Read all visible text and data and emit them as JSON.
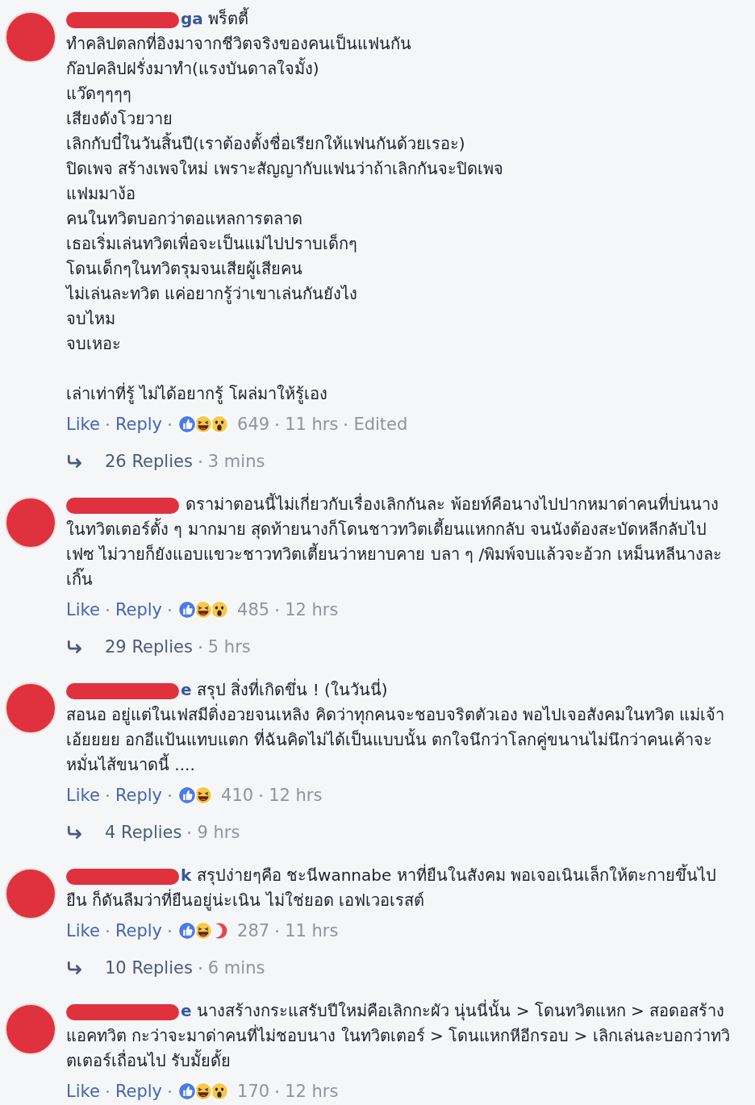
{
  "comments": [
    {
      "name": "ga",
      "text": "พร็ตตี้\nทำคลิปตลกที่อิงมาจากชีวิตจริงของคนเป็นแฟนกัน\nก๊อปคลิปฝรั่งมาทำ(แรงบันดาลใจมั้ง)\nแว๊ดๆๆๆๆ\nเสียงดังโวยวาย\nเลิกกับบี๋ในวันสิ้นปี(เราต้องตั้งชื่อเรียกให้แฟนกันด้วยเรอะ)\nปิดเพจ สร้างเพจใหม่ เพราะสัญญากับแฟนว่าถ้าเลิกกันจะปิดเพจ\nแฟมมาง้อ\nคนในทวิตบอกว่าตอแหลการตลาด\nเธอเริ่มเล่นทวิตเพื่อจะเป็นแม่ไปปราบเด็กๆ\nโดนเด็กๆในทวิตรุมจนเสียผู้เสียคน\nไม่เล่นละทวิต แค่อยากรู้ว่าเขาเล่นกันยังไง\nจบไหม\nจบเหอะ\n\nเล่าเท่าที่รู้ ไม่ได้อยากรู้ โผล่มาให้รู้เอง",
      "like": "Like",
      "reply": "Reply",
      "reactions": [
        {
          "kind": "like"
        },
        {
          "kind": "haha"
        },
        {
          "kind": "wow"
        }
      ],
      "count": "649",
      "time": "11 hrs",
      "edited": "Edited",
      "replies": "26 Replies",
      "replies_time": "3 mins"
    },
    {
      "text": "ดราม่าตอนนี้ไม่เกี่ยวกับเรื่องเลิกกันละ พ้อยท์คือนางไปปากหมาด่าคนที่บ่นนางในทวิตเตอร์ตั้ง ๆ มากมาย สุดท้ายนางก็โดนชาวทวิตเตี้ยนแหกกลับ จนนังต้องสะบัดหลีกลับไปเฟซ ไม่วายก็ยังแอบแขวะชาวทวิตเตี้ยนว่าหยาบคาย บลา ๆ /พิมพ์จบแล้วจะอ้วก เหม็นหลีนางละเกิ๊น",
      "like": "Like",
      "reply": "Reply",
      "reactions": [
        {
          "kind": "like"
        },
        {
          "kind": "haha"
        },
        {
          "kind": "wow"
        }
      ],
      "count": "485",
      "time": "12 hrs",
      "replies": "29 Replies",
      "replies_time": "5 hrs"
    },
    {
      "name": "e",
      "text": "สรุป สิ่งที่เกิดขึ่น ! (ในวันนี่)\nสอนอ อยู่แต่ในเฟสมีติ่งอวยจนเหลิง คิดว่าทุกคนจะชอบจริตตัวเอง พอไปเจอสังคมในทวิต แม่เจ้าเอ้ยยยย อกอีแป้นแทบแตก ที่ฉันคิดไม่ได้เป็นแบบนั้น ตกใจนึกว่าโลกคู่ขนานไม่นึกว่าคนเค้าจะหมั่นไส้ขนาดนี้ ....",
      "like": "Like",
      "reply": "Reply",
      "reactions": [
        {
          "kind": "like"
        },
        {
          "kind": "haha"
        }
      ],
      "count": "410",
      "time": "12 hrs",
      "replies": "4 Replies",
      "replies_time": "9 hrs"
    },
    {
      "name": "k",
      "text": "สรุปง่ายๆคือ ชะนีwannabe หาที่ยืนในสังคม พอเจอเนินเล็กให้ตะกายขึ้นไปยืน ก็ดันลืมว่าที่ยืนอยู่น่ะเนิน ไม่ใช่ยอด เอฟเวอเรสต์",
      "like": "Like",
      "reply": "Reply",
      "reactions": [
        {
          "kind": "like"
        },
        {
          "kind": "haha"
        },
        {
          "kind": "angry"
        }
      ],
      "count": "287",
      "time": "11 hrs",
      "replies": "10 Replies",
      "replies_time": "6 mins"
    },
    {
      "name": "e",
      "text": "นางสร้างกระแสรับปีใหม่คือเลิกกะผัว นุ่นนี่นั้น > โดนทวิตแหก > สอดอสร้างแอคทวิต กะว่าจะมาด่าคนที่ไม่ชอบนาง ในทวิตเตอร์ > โดนแหกหีอีกรอบ > เลิกเล่นละบอกว่าทวิตเตอร์เถื่อนไป รับมั้ยดั้ย",
      "like": "Like",
      "reply": "Reply",
      "reactions": [
        {
          "kind": "like"
        },
        {
          "kind": "haha"
        },
        {
          "kind": "wow"
        }
      ],
      "count": "170",
      "time": "12 hrs"
    }
  ]
}
